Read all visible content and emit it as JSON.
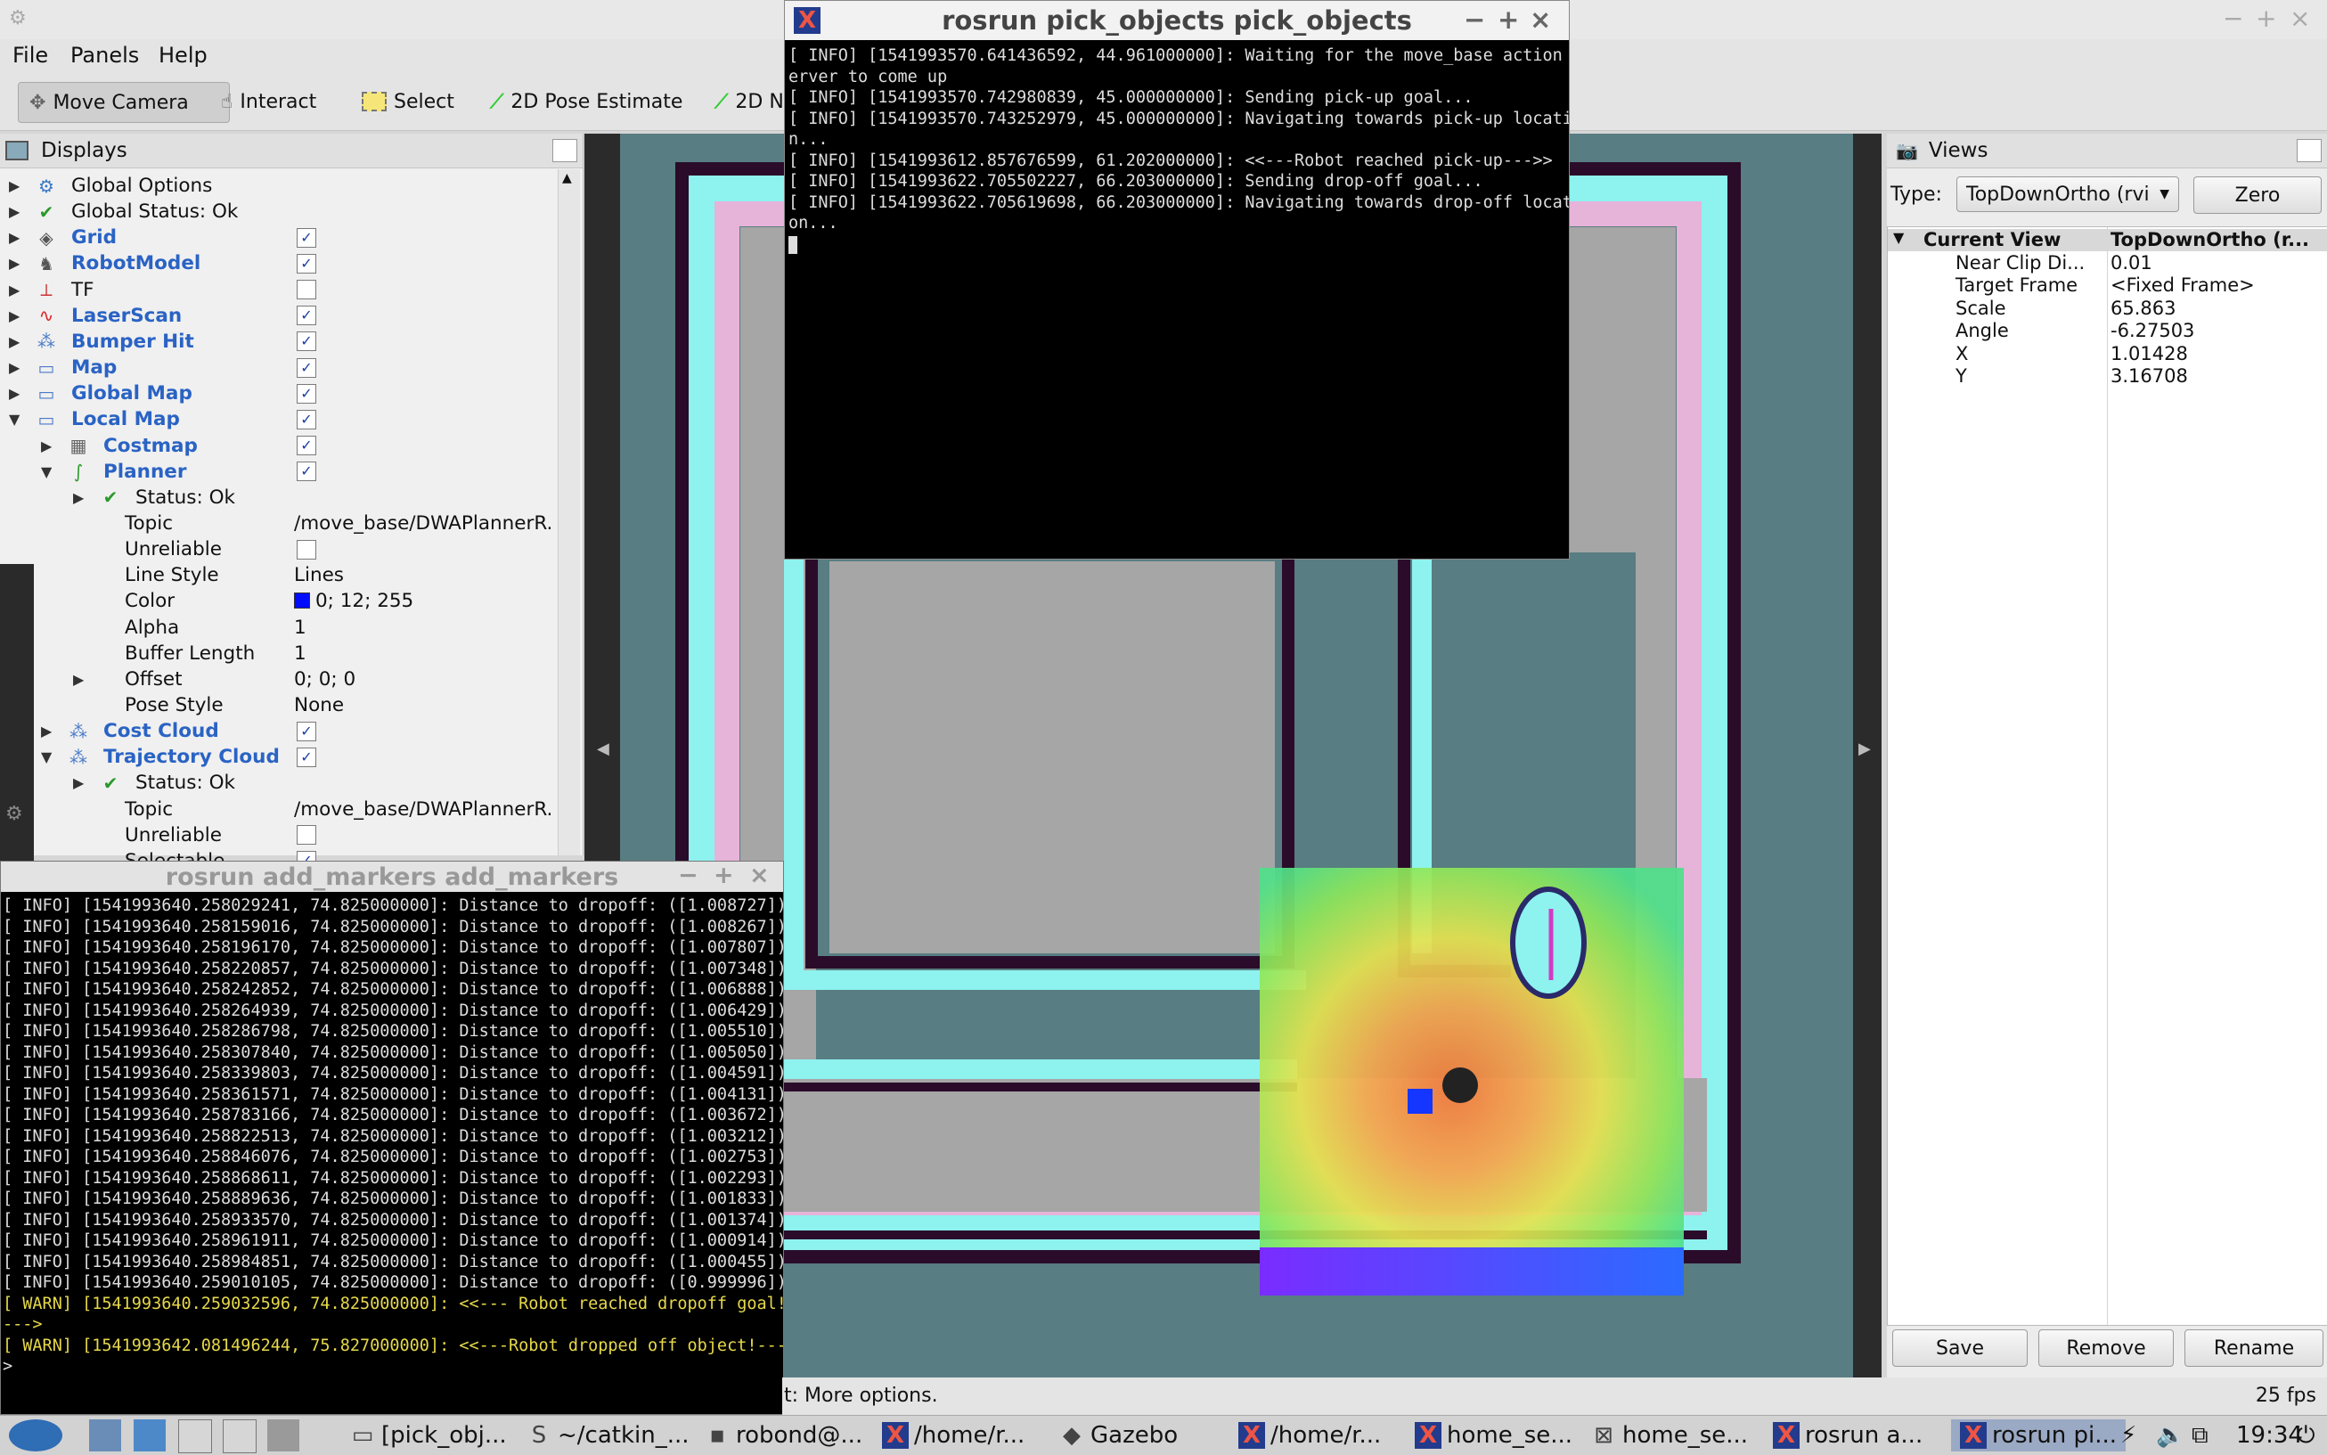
{
  "menubar": {
    "file": "File",
    "panels": "Panels",
    "help": "Help"
  },
  "toolbar": {
    "move_camera": "Move Camera",
    "interact": "Interact",
    "select": "Select",
    "pose_estimate": "2D Pose Estimate",
    "nav_goal_partial": "2D N"
  },
  "displays": {
    "title": "Displays",
    "rows": [
      {
        "label": "Global Options"
      },
      {
        "label": "Global Status: Ok"
      },
      {
        "label": "Grid"
      },
      {
        "label": "RobotModel"
      },
      {
        "label": "TF"
      },
      {
        "label": "LaserScan"
      },
      {
        "label": "Bumper Hit"
      },
      {
        "label": "Map"
      },
      {
        "label": "Global Map"
      },
      {
        "label": "Local Map"
      },
      {
        "label": "Costmap"
      },
      {
        "label": "Planner"
      },
      {
        "label": "Status: Ok"
      },
      {
        "label": "Topic",
        "value": "/move_base/DWAPlannerR."
      },
      {
        "label": "Unreliable"
      },
      {
        "label": "Line Style",
        "value": "Lines"
      },
      {
        "label": "Color",
        "value": "0; 12; 255"
      },
      {
        "label": "Alpha",
        "value": "1"
      },
      {
        "label": "Buffer Length",
        "value": "1"
      },
      {
        "label": "Offset",
        "value": "0; 0; 0"
      },
      {
        "label": "Pose Style",
        "value": "None"
      },
      {
        "label": "Cost Cloud"
      },
      {
        "label": "Trajectory Cloud"
      },
      {
        "label": "Status: Ok"
      },
      {
        "label": "Topic",
        "value": "/move_base/DWAPlannerR."
      },
      {
        "label": "Unreliable"
      },
      {
        "label": "Selectable"
      }
    ]
  },
  "pick_terminal": {
    "title": "rosrun pick_objects pick_objects",
    "lines": [
      "[ INFO] [1541993570.641436592, 44.961000000]: Waiting for the move_base action s",
      "erver to come up",
      "[ INFO] [1541993570.742980839, 45.000000000]: Sending pick-up goal...",
      "[ INFO] [1541993570.743252979, 45.000000000]: Navigating towards pick-up locatio",
      "n...",
      "[ INFO] [1541993612.857676599, 61.202000000]: <<---Robot reached pick-up--->>",
      "[ INFO] [1541993622.705502227, 66.203000000]: Sending drop-off goal...",
      "[ INFO] [1541993622.705619698, 66.203000000]: Navigating towards drop-off locati",
      "on..."
    ]
  },
  "markers_terminal": {
    "title": "rosrun add_markers add_markers",
    "info_lines": [
      "[ INFO] [1541993640.258029241, 74.825000000]: Distance to dropoff: ([1.008727])",
      "[ INFO] [1541993640.258159016, 74.825000000]: Distance to dropoff: ([1.008267])",
      "[ INFO] [1541993640.258196170, 74.825000000]: Distance to dropoff: ([1.007807])",
      "[ INFO] [1541993640.258220857, 74.825000000]: Distance to dropoff: ([1.007348])",
      "[ INFO] [1541993640.258242852, 74.825000000]: Distance to dropoff: ([1.006888])",
      "[ INFO] [1541993640.258264939, 74.825000000]: Distance to dropoff: ([1.006429])",
      "[ INFO] [1541993640.258286798, 74.825000000]: Distance to dropoff: ([1.005510])",
      "[ INFO] [1541993640.258307840, 74.825000000]: Distance to dropoff: ([1.005050])",
      "[ INFO] [1541993640.258339803, 74.825000000]: Distance to dropoff: ([1.004591])",
      "[ INFO] [1541993640.258361571, 74.825000000]: Distance to dropoff: ([1.004131])",
      "[ INFO] [1541993640.258783166, 74.825000000]: Distance to dropoff: ([1.003672])",
      "[ INFO] [1541993640.258822513, 74.825000000]: Distance to dropoff: ([1.003212])",
      "[ INFO] [1541993640.258846076, 74.825000000]: Distance to dropoff: ([1.002753])",
      "[ INFO] [1541993640.258868611, 74.825000000]: Distance to dropoff: ([1.002293])",
      "[ INFO] [1541993640.258889636, 74.825000000]: Distance to dropoff: ([1.001833])",
      "[ INFO] [1541993640.258933570, 74.825000000]: Distance to dropoff: ([1.001374])",
      "[ INFO] [1541993640.258961911, 74.825000000]: Distance to dropoff: ([1.000914])",
      "[ INFO] [1541993640.258984851, 74.825000000]: Distance to dropoff: ([1.000455])",
      "[ INFO] [1541993640.259010105, 74.825000000]: Distance to dropoff: ([0.999996])"
    ],
    "warn1": "[ WARN] [1541993640.259032596, 74.825000000]: <<--- Robot reached dropoff goal!",
    "warn1_cont": "--->",
    "warn2": "[ WARN] [1541993642.081496244, 75.827000000]: <<---Robot dropped off object!--->",
    "prompt": ">"
  },
  "views": {
    "title": "Views",
    "type_label": "Type:",
    "type_value": "TopDownOrtho (rvi",
    "zero": "Zero",
    "current_view_label": "Current View",
    "current_view_value": "TopDownOrtho (r...",
    "props": [
      {
        "label": "Near Clip Di...",
        "value": "0.01"
      },
      {
        "label": "Target Frame",
        "value": "<Fixed Frame>"
      },
      {
        "label": "Scale",
        "value": "65.863"
      },
      {
        "label": "Angle",
        "value": "-6.27503"
      },
      {
        "label": "X",
        "value": "1.01428"
      },
      {
        "label": "Y",
        "value": "3.16708"
      }
    ],
    "save": "Save",
    "remove": "Remove",
    "rename": "Rename"
  },
  "status": {
    "hint": "t: More options.",
    "fps": "25 fps"
  },
  "taskbar": {
    "items": [
      "[pick_obj...",
      "~/catkin_...",
      "robond@...",
      "/home/r...",
      "Gazebo",
      "/home/r...",
      "home_se...",
      "home_se...",
      "rosrun a...",
      "rosrun pi..."
    ],
    "clock": "19:34"
  },
  "colors": {
    "planner_color": "#000cff",
    "link_blue": "#2a63c4",
    "warn": "#e6d84a"
  }
}
